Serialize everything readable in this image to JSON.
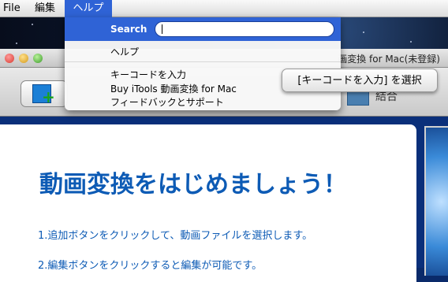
{
  "menubar": {
    "items": [
      "File",
      "編集",
      "ヘルプ"
    ]
  },
  "window": {
    "title": "画変換 for Mac(未登録)"
  },
  "toolbar": {
    "merge_label": "結合"
  },
  "content": {
    "heading": "動画変換をはじめましょう！",
    "step1": "1.追加ボタンをクリックして、動画ファイルを選択します。",
    "step2": "2.編集ボタンをクリックすると編集が可能です。"
  },
  "help_menu": {
    "search_label": "Search",
    "search_value": "",
    "items": [
      "ヘルプ",
      "キーコードを入力",
      "Buy iTools 動画変換 for Mac",
      "フィードバックとサポート"
    ]
  },
  "tooltip": {
    "text": "[キーコードを入力] を選択"
  },
  "colors": {
    "menu_highlight": "#2f63d6",
    "heading_blue": "#0d5bb5"
  }
}
